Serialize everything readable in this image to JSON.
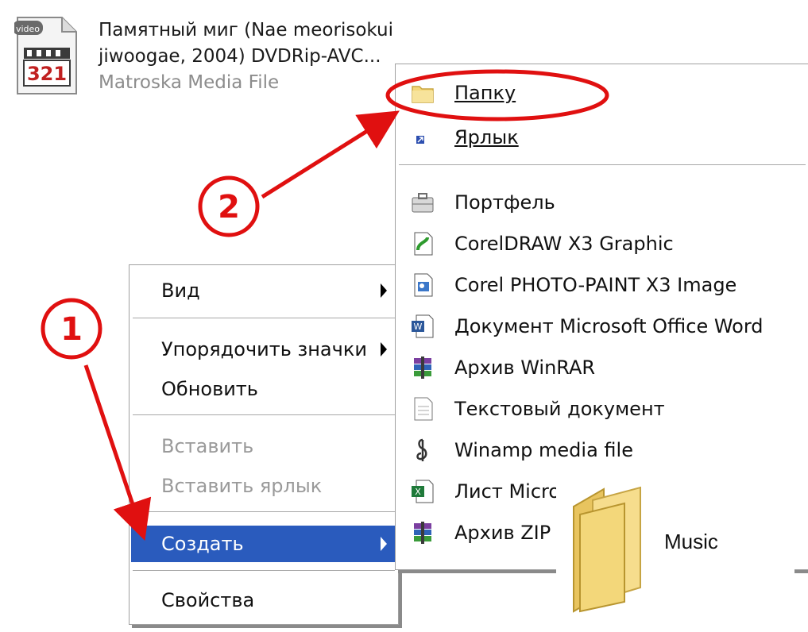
{
  "file": {
    "badge": "video",
    "icon_digits": "321",
    "name_line1": "Памятный миг (Nae meorisokui",
    "name_line2": "jiwoogae, 2004) DVDRip-AVC...",
    "type": "Matroska Media File"
  },
  "context_menu": {
    "items": [
      {
        "label": "Вид"
      },
      {
        "label": "Упорядочить значки"
      },
      {
        "label": "Обновить"
      },
      {
        "label": "Вставить"
      },
      {
        "label": "Вставить ярлык"
      },
      {
        "label": "Создать"
      },
      {
        "label": "Свойства"
      }
    ]
  },
  "submenu": {
    "items": [
      {
        "label": "Папку",
        "icon": "folder-icon"
      },
      {
        "label": "Ярлык",
        "icon": "shortcut-icon"
      },
      {
        "label": "Портфель",
        "icon": "briefcase-icon"
      },
      {
        "label": "CorelDRAW X3 Graphic",
        "icon": "coreldraw-icon"
      },
      {
        "label": "Corel PHOTO-PAINT X3 Image",
        "icon": "corel-photopaint-icon"
      },
      {
        "label": "Документ Microsoft Office Word",
        "icon": "word-document-icon"
      },
      {
        "label": "Архив WinRAR",
        "icon": "winrar-icon"
      },
      {
        "label": "Текстовый документ",
        "icon": "text-document-icon"
      },
      {
        "label": "Winamp media file",
        "icon": "winamp-icon"
      },
      {
        "label": "Лист Micros",
        "icon": "excel-sheet-icon"
      },
      {
        "label": "Архив ZIP -",
        "icon": "zip-archive-icon"
      }
    ]
  },
  "annotations": {
    "step1": "1",
    "step2": "2"
  },
  "music_folder": {
    "label": "Music"
  },
  "colors": {
    "selection": "#2a5bbd",
    "annotation_red": "#e01010",
    "folder_yellow": "#f3d77a"
  }
}
